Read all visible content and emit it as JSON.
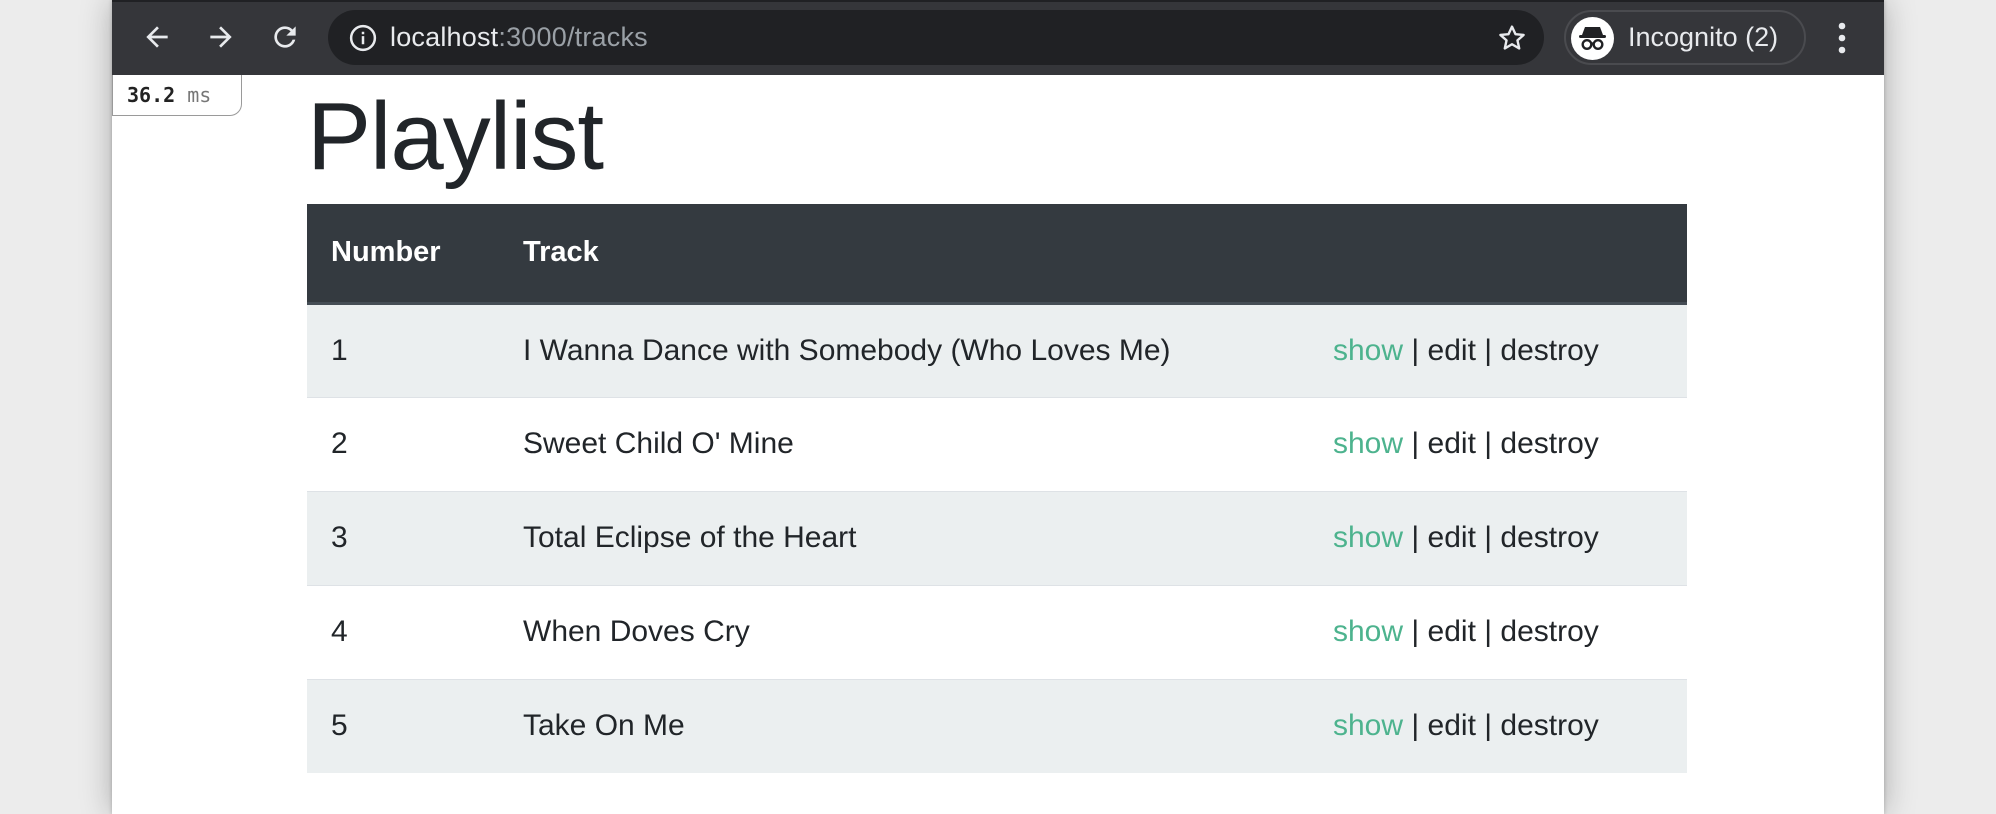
{
  "browser": {
    "url_host": "localhost",
    "url_path": ":3000/tracks",
    "profile_label": "Incognito (2)"
  },
  "profiler": {
    "value": "36.2",
    "unit": "ms"
  },
  "page": {
    "title": "Playlist"
  },
  "table": {
    "headers": [
      "Number",
      "Track",
      ""
    ],
    "rows": [
      {
        "number": "1",
        "track": "I Wanna Dance with Somebody (Who Loves Me)",
        "show": "show",
        "edit": "edit",
        "destroy": "destroy"
      },
      {
        "number": "2",
        "track": "Sweet Child O' Mine",
        "show": "show",
        "edit": "edit",
        "destroy": "destroy"
      },
      {
        "number": "3",
        "track": "Total Eclipse of the Heart",
        "show": "show",
        "edit": "edit",
        "destroy": "destroy"
      },
      {
        "number": "4",
        "track": "When Doves Cry",
        "show": "show",
        "edit": "edit",
        "destroy": "destroy"
      },
      {
        "number": "5",
        "track": "Take On Me",
        "show": "show",
        "edit": "edit",
        "destroy": "destroy"
      }
    ],
    "separator": "|"
  },
  "colors": {
    "toolbar": "#35363a",
    "omnibox": "#202124",
    "table_header": "#343a40",
    "stripe": "#ebeff0",
    "link_show": "#4db38e"
  },
  "icons": {
    "back": "back-arrow-icon",
    "forward": "forward-arrow-icon",
    "reload": "reload-icon",
    "site_info": "info-icon",
    "bookmark": "star-icon",
    "incognito": "incognito-icon",
    "menu": "more-vertical-icon"
  }
}
